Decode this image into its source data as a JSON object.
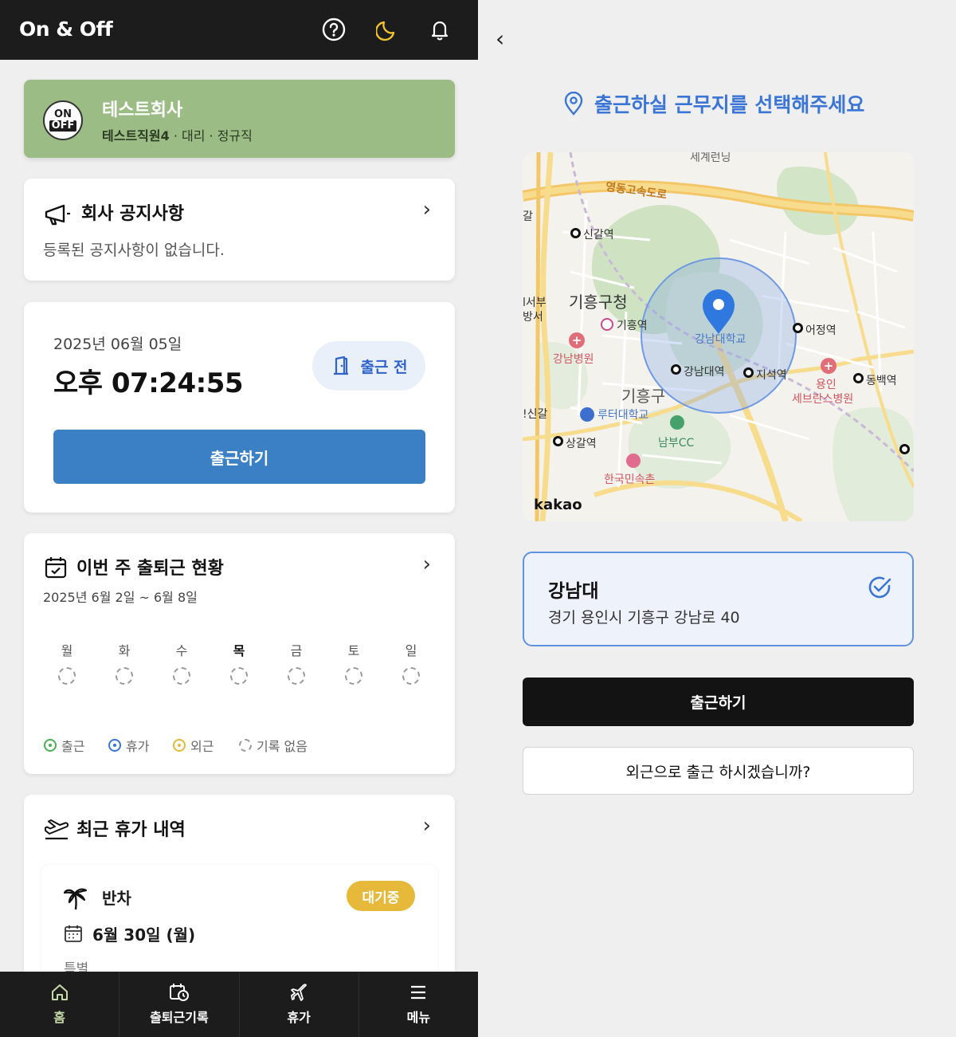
{
  "app": {
    "brand": "On & Off"
  },
  "header_icons": [
    "help-circle-icon",
    "moon-icon",
    "bell-icon"
  ],
  "company": {
    "logo_on": "ON",
    "logo_off": "OFF",
    "name": "테스트회사",
    "employee": "테스트직원4",
    "position_info": " · 대리 · 정규직"
  },
  "notice": {
    "title": "회사 공지사항",
    "empty": "등록된 공지사항이 없습니다."
  },
  "clock": {
    "date": "2025년 06월 05일",
    "time": "오후 07:24:55",
    "status": "출근 전",
    "button": "출근하기"
  },
  "week": {
    "title": "이번 주 출퇴근 현황",
    "range": "2025년 6월 2일 ~ 6월 8일",
    "days": [
      "월",
      "화",
      "수",
      "목",
      "금",
      "토",
      "일"
    ],
    "today_index": 3,
    "legend": [
      {
        "label": "출근",
        "color": "#4caf50"
      },
      {
        "label": "휴가",
        "color": "#3b76d6"
      },
      {
        "label": "외근",
        "color": "#e6b93a"
      },
      {
        "label": "기록 없음",
        "color": "#999999"
      }
    ]
  },
  "vacation": {
    "title": "최근 휴가 내역",
    "item": {
      "type": "반차",
      "badge": "대기중",
      "date": "6월 30일 (월)",
      "note": "특별"
    }
  },
  "nav": [
    {
      "label": "홈",
      "icon": "home-icon",
      "active": true
    },
    {
      "label": "출퇴근기록",
      "icon": "calendar-clock-icon",
      "active": false
    },
    {
      "label": "휴가",
      "icon": "airplane-icon",
      "active": false
    },
    {
      "label": "메뉴",
      "icon": "menu-icon",
      "active": false
    }
  ],
  "select": {
    "title": "출근하실 근무지를 선택해주세요",
    "map": {
      "labels": {
        "highway": "영동고속도로",
        "top": "세계런닝",
        "singal": "신갈역",
        "giheung_office": "기흥구청",
        "giheung_stn": "기흥역",
        "gangnam_hosp": "강남병원",
        "univ": "강남대학교",
        "gangnamdae_stn": "강남대역",
        "jiseok": "지석역",
        "eojeong": "어정역",
        "yongin": "용인",
        "severance": "세브란스병원",
        "dongbaek": "동백역",
        "giheunggu": "기흥구",
        "luther": "루터대학교",
        "sanggal": "상갈역",
        "nambu": "남부CC",
        "folk": "한국민속촌",
        "seobu": "l서부",
        "bangseo": "방서",
        "singal_left": "!신갈",
        "gal": "갈"
      },
      "attribution": "kakao"
    },
    "location": {
      "name": "강남대",
      "address": "경기 용인시 기흥구 강남로 40"
    },
    "primary_button": "출근하기",
    "secondary_button": "외근으로 출근 하시겠습니까?"
  }
}
